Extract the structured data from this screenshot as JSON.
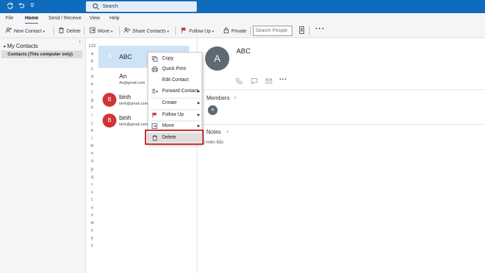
{
  "titlebar": {
    "search_label": "Search",
    "icons": [
      "sync-icon",
      "undo-icon",
      "customize-toolbar-icon"
    ],
    "color": "#0f6cbd"
  },
  "menu": {
    "tabs": [
      "File",
      "Home",
      "Send / Receive",
      "View",
      "Help"
    ],
    "active": "Home"
  },
  "ribbon": {
    "new_contact": "New Contact",
    "delete": "Delete",
    "move": "Move",
    "share_contacts": "Share Contacts",
    "follow_up": "Follow Up",
    "private": "Private",
    "search_people_placeholder": "Search People"
  },
  "leftnav": {
    "header": "My Contacts",
    "item": "Contacts (This computer only)"
  },
  "alphabet": [
    "123",
    "a",
    "b",
    "c",
    "d",
    "e",
    "f",
    "g",
    "h",
    "i",
    "j",
    "k",
    "l",
    "m",
    "n",
    "o",
    "p",
    "q",
    "r",
    "s",
    "t",
    "u",
    "v",
    "w",
    "x",
    "y",
    "z"
  ],
  "contacts": [
    {
      "initial": "A",
      "name": "ABC",
      "email": "",
      "color": "#5e6a71"
    },
    {
      "initial": "A",
      "name": "An",
      "email": "An@gmail.com",
      "color": "#5e6a71"
    },
    {
      "initial": "B",
      "name": "binh",
      "email": "binh@gmail.com",
      "color": "#d13438"
    },
    {
      "initial": "B",
      "name": "binh",
      "email": "binh@gmail.com",
      "color": "#d13438"
    }
  ],
  "context_menu": {
    "copy": "Copy",
    "quick_print": "Quick Print",
    "edit_contact": "Edit Contact",
    "forward_contact": "Forward Contact",
    "create": "Create",
    "follow_up": "Follow Up",
    "move": "Move",
    "delete": "Delete",
    "highlight_color": "#c62828"
  },
  "reading_pane": {
    "initial": "A",
    "name": "ABC",
    "members_label": "Members",
    "member_initial": "A",
    "notes_label": "Notes",
    "note_text": "ngũ miền Bắc"
  }
}
